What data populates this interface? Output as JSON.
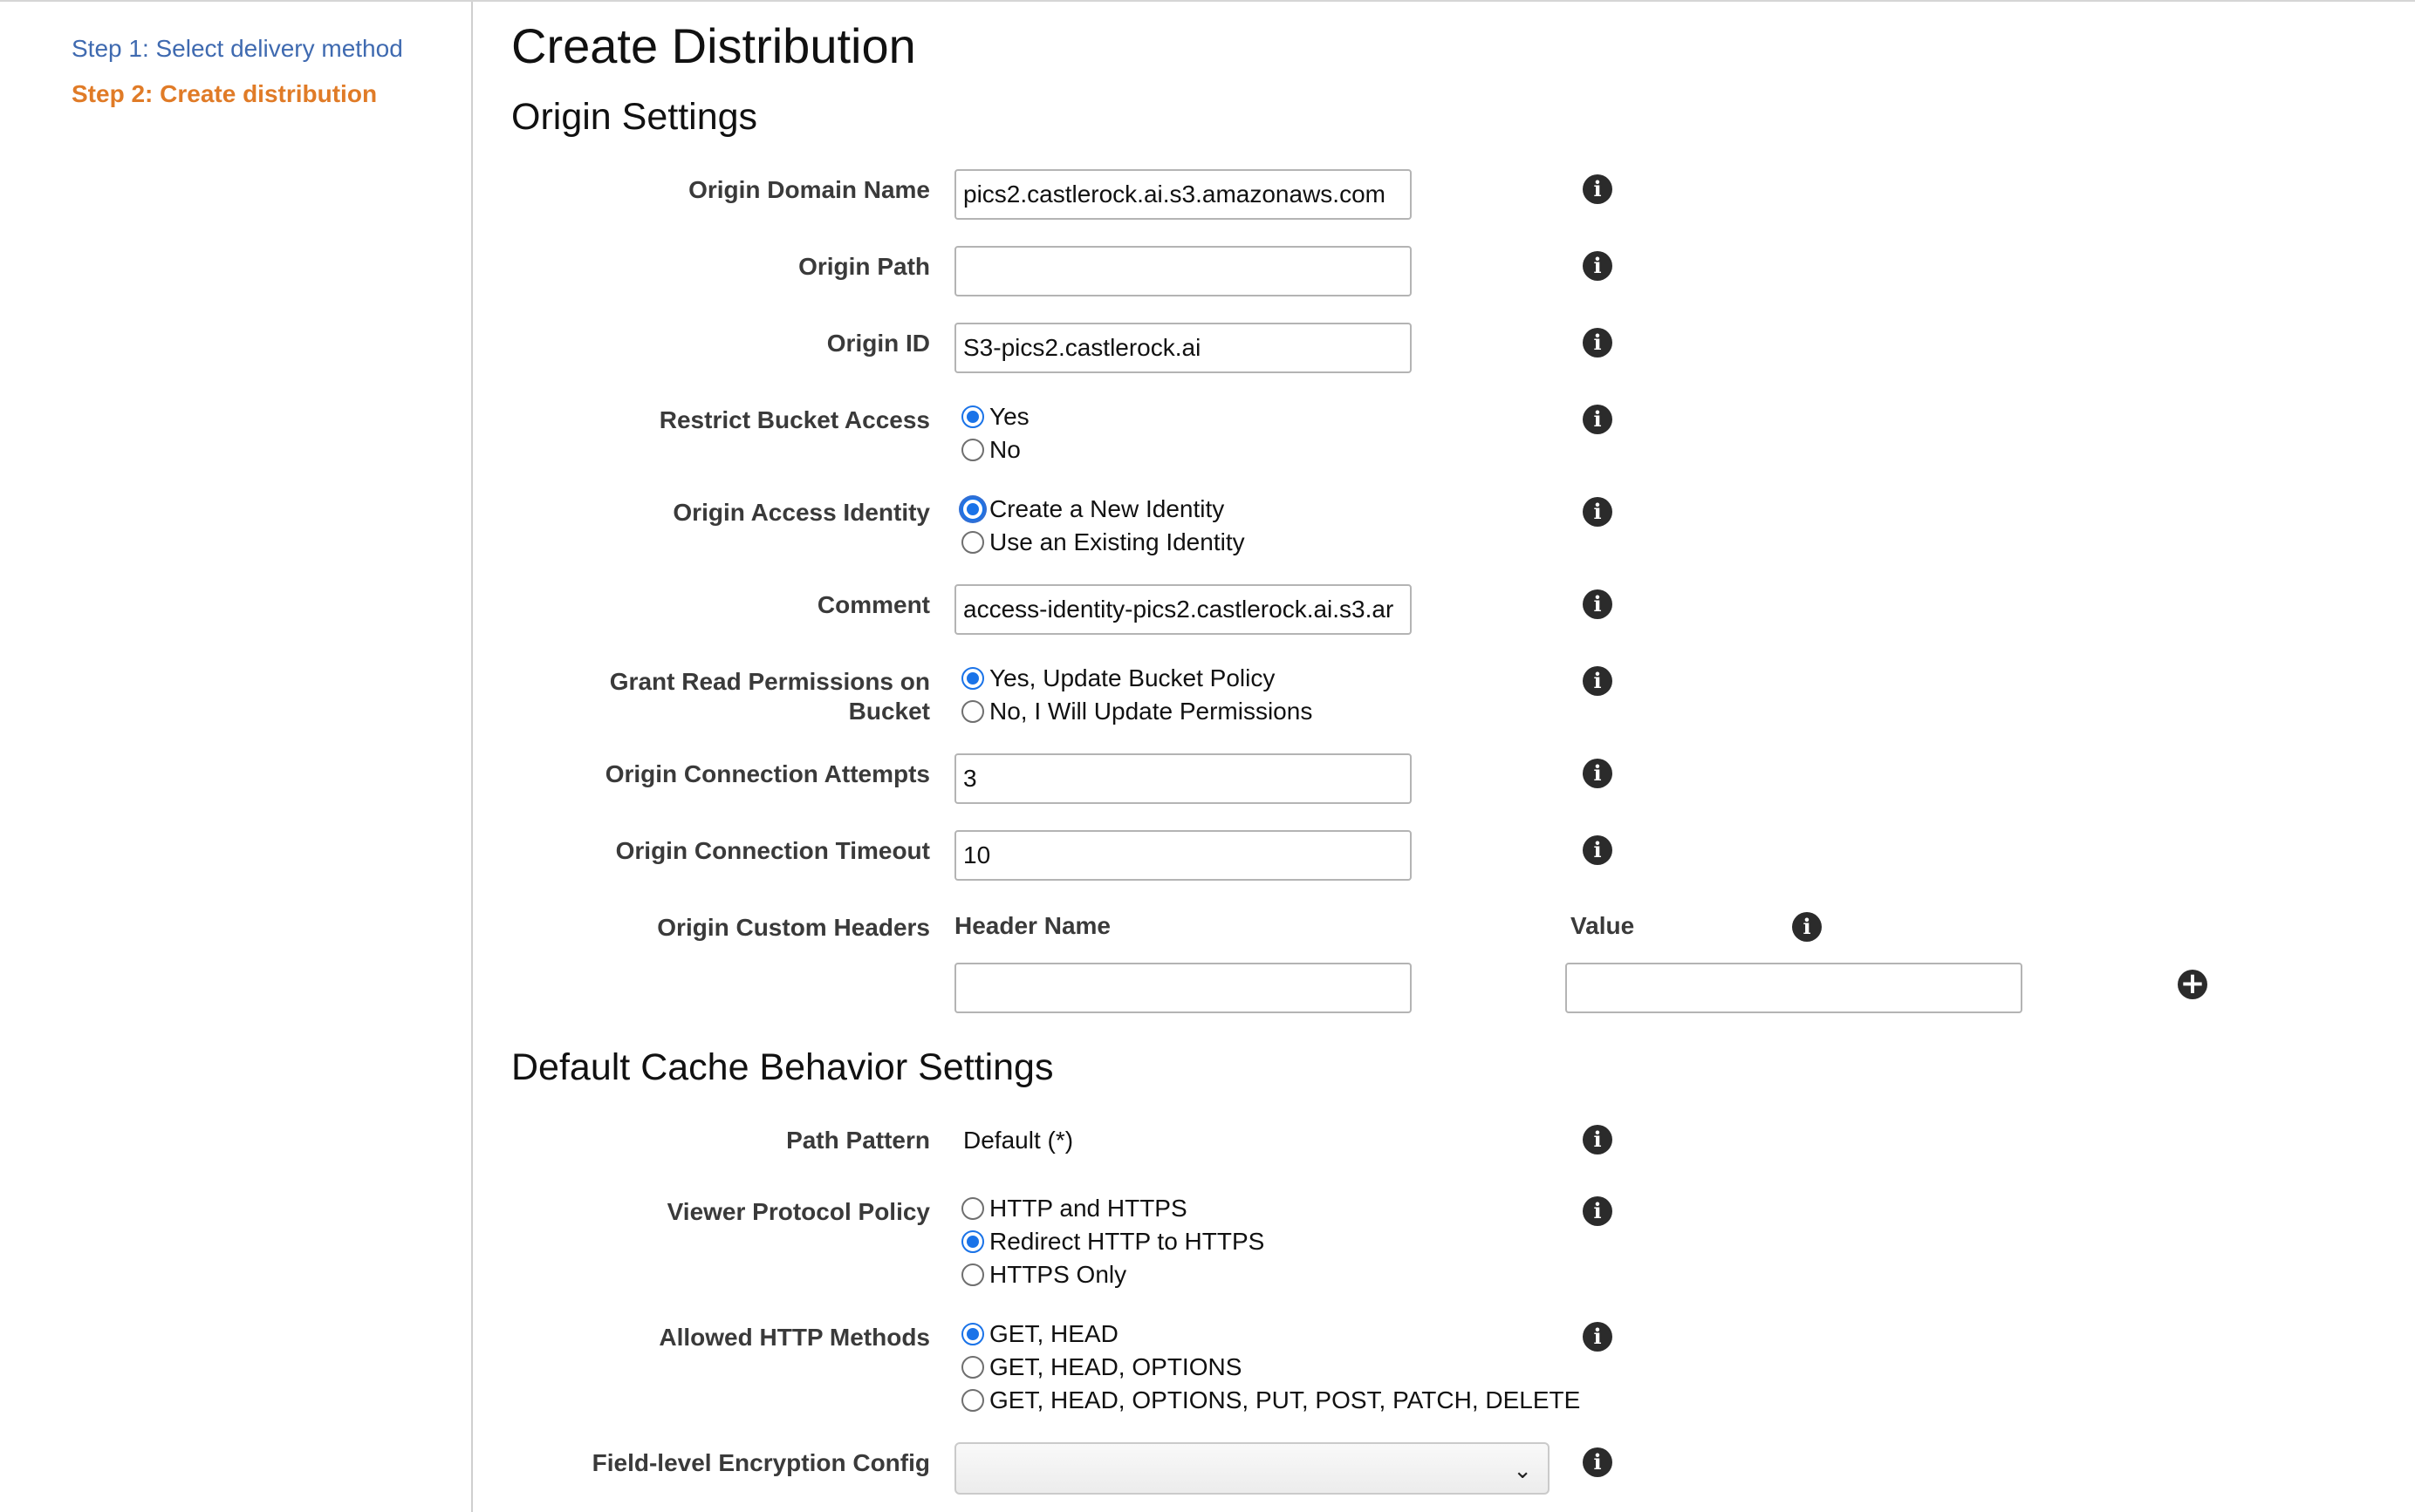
{
  "sidebar": {
    "step1": "Step 1: Select delivery method",
    "step2": "Step 2: Create distribution"
  },
  "page": {
    "title": "Create Distribution"
  },
  "origin": {
    "section_title": "Origin Settings",
    "domain_name": {
      "label": "Origin Domain Name",
      "value": "pics2.castlerock.ai.s3.amazonaws.com"
    },
    "path": {
      "label": "Origin Path",
      "value": ""
    },
    "id": {
      "label": "Origin ID",
      "value": "S3-pics2.castlerock.ai"
    },
    "restrict_bucket": {
      "label": "Restrict Bucket Access",
      "options": [
        "Yes",
        "No"
      ],
      "selected": "Yes"
    },
    "access_identity": {
      "label": "Origin Access Identity",
      "options": [
        "Create a New Identity",
        "Use an Existing Identity"
      ],
      "selected": "Create a New Identity"
    },
    "comment": {
      "label": "Comment",
      "value": "access-identity-pics2.castlerock.ai.s3.ar"
    },
    "grant_read": {
      "label_line1": "Grant Read Permissions on",
      "label_line2": "Bucket",
      "options": [
        "Yes, Update Bucket Policy",
        "No, I Will Update Permissions"
      ],
      "selected": "Yes, Update Bucket Policy"
    },
    "conn_attempts": {
      "label": "Origin Connection Attempts",
      "value": "3"
    },
    "conn_timeout": {
      "label": "Origin Connection Timeout",
      "value": "10"
    },
    "custom_headers": {
      "label": "Origin Custom Headers",
      "col_name": "Header Name",
      "col_value": "Value",
      "name_value": "",
      "value_value": ""
    }
  },
  "cache": {
    "section_title": "Default Cache Behavior Settings",
    "path_pattern": {
      "label": "Path Pattern",
      "value": "Default (*)"
    },
    "viewer_protocol": {
      "label": "Viewer Protocol Policy",
      "options": [
        "HTTP and HTTPS",
        "Redirect HTTP to HTTPS",
        "HTTPS Only"
      ],
      "selected": "Redirect HTTP to HTTPS"
    },
    "allowed_methods": {
      "label": "Allowed HTTP Methods",
      "options": [
        "GET, HEAD",
        "GET, HEAD, OPTIONS",
        "GET, HEAD, OPTIONS, PUT, POST, PATCH, DELETE"
      ],
      "selected": "GET, HEAD"
    },
    "fle_config": {
      "label": "Field-level Encryption Config",
      "value": ""
    }
  },
  "icons": {
    "info": "i",
    "plus": "+",
    "chevron": "⌄"
  },
  "colors": {
    "link": "#3f6ab0",
    "active_step": "#e07b27",
    "radio_checked": "#1a73e8"
  }
}
